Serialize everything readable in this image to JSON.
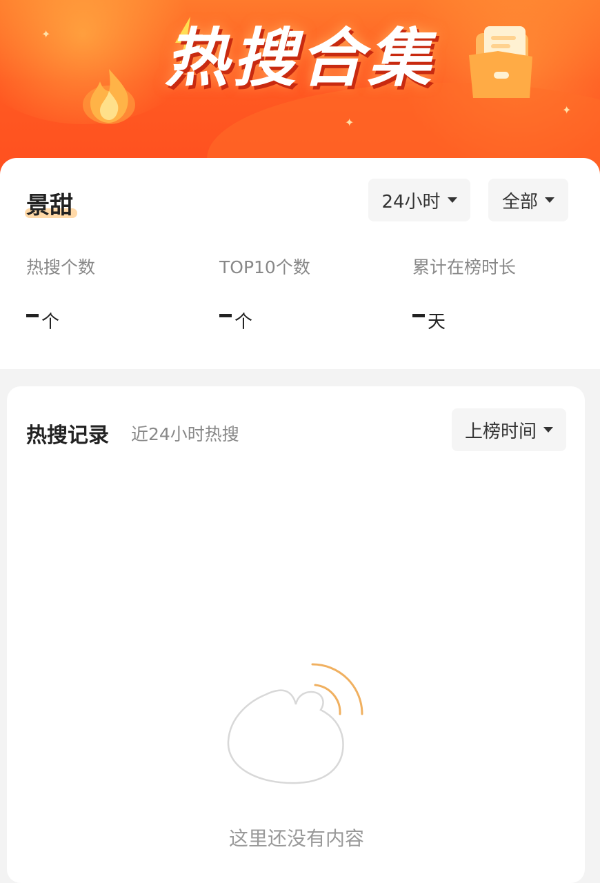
{
  "banner": {
    "title": "热搜合集"
  },
  "profile": {
    "name": "景甜"
  },
  "filters": {
    "time_range": "24小时",
    "scope": "全部"
  },
  "stats": [
    {
      "label": "热搜个数",
      "value": "-",
      "unit": "个"
    },
    {
      "label": "TOP10个数",
      "value": "-",
      "unit": "个"
    },
    {
      "label": "累计在榜时长",
      "value": "-",
      "unit": "天"
    }
  ],
  "records": {
    "title": "热搜记录",
    "subtitle": "近24小时热搜",
    "sort_label": "上榜时间",
    "empty_text": "这里还没有内容"
  },
  "colors": {
    "banner_orange": "#ff5a22",
    "highlight": "#ffd9a8",
    "signal_arc": "#f0b060"
  },
  "icons": {
    "flame": "flame-icon",
    "folder": "folder-icon",
    "bolt": "lightning-icon",
    "empty": "empty-state-illustration"
  }
}
